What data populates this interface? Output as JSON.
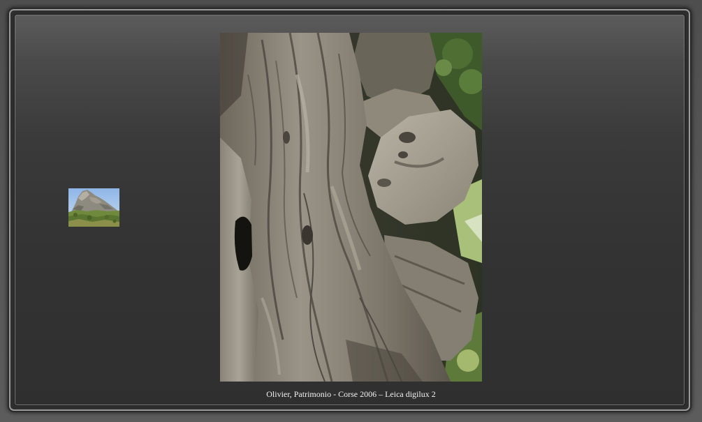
{
  "gallery": {
    "caption": "Olivier, Patrimonio - Corse 2006 – Leica digilux 2",
    "thumbnail": {
      "icon": "rocky-outcrop-photo-thumbnail"
    },
    "main_photo": {
      "icon": "olive-tree-trunk-photo"
    }
  },
  "colors": {
    "frame_border": "#9a9a9a",
    "panel_top": "#5c5c5c",
    "panel_bottom": "#2f2f2f",
    "caption_text": "#f2f2f2"
  }
}
